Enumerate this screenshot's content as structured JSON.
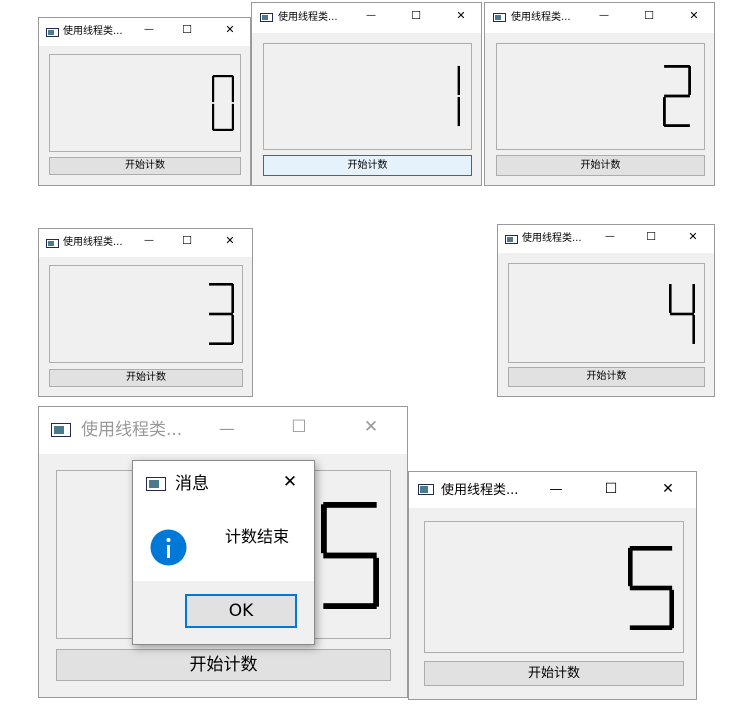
{
  "window_title": "使用线程类...",
  "controls": {
    "minimize": "—",
    "maximize": "☐",
    "close": "✕"
  },
  "start_button_label": "开始计数",
  "digits": [
    "0",
    "1",
    "2",
    "3",
    "4",
    "5",
    "5"
  ],
  "message_box": {
    "title": "消息",
    "text": "计数结束",
    "ok_label": "OK",
    "icon": "info-icon"
  },
  "colors": {
    "lcd_segment": "#000000",
    "info_blue": "#0078d7",
    "focus_border": "#0078d7"
  }
}
